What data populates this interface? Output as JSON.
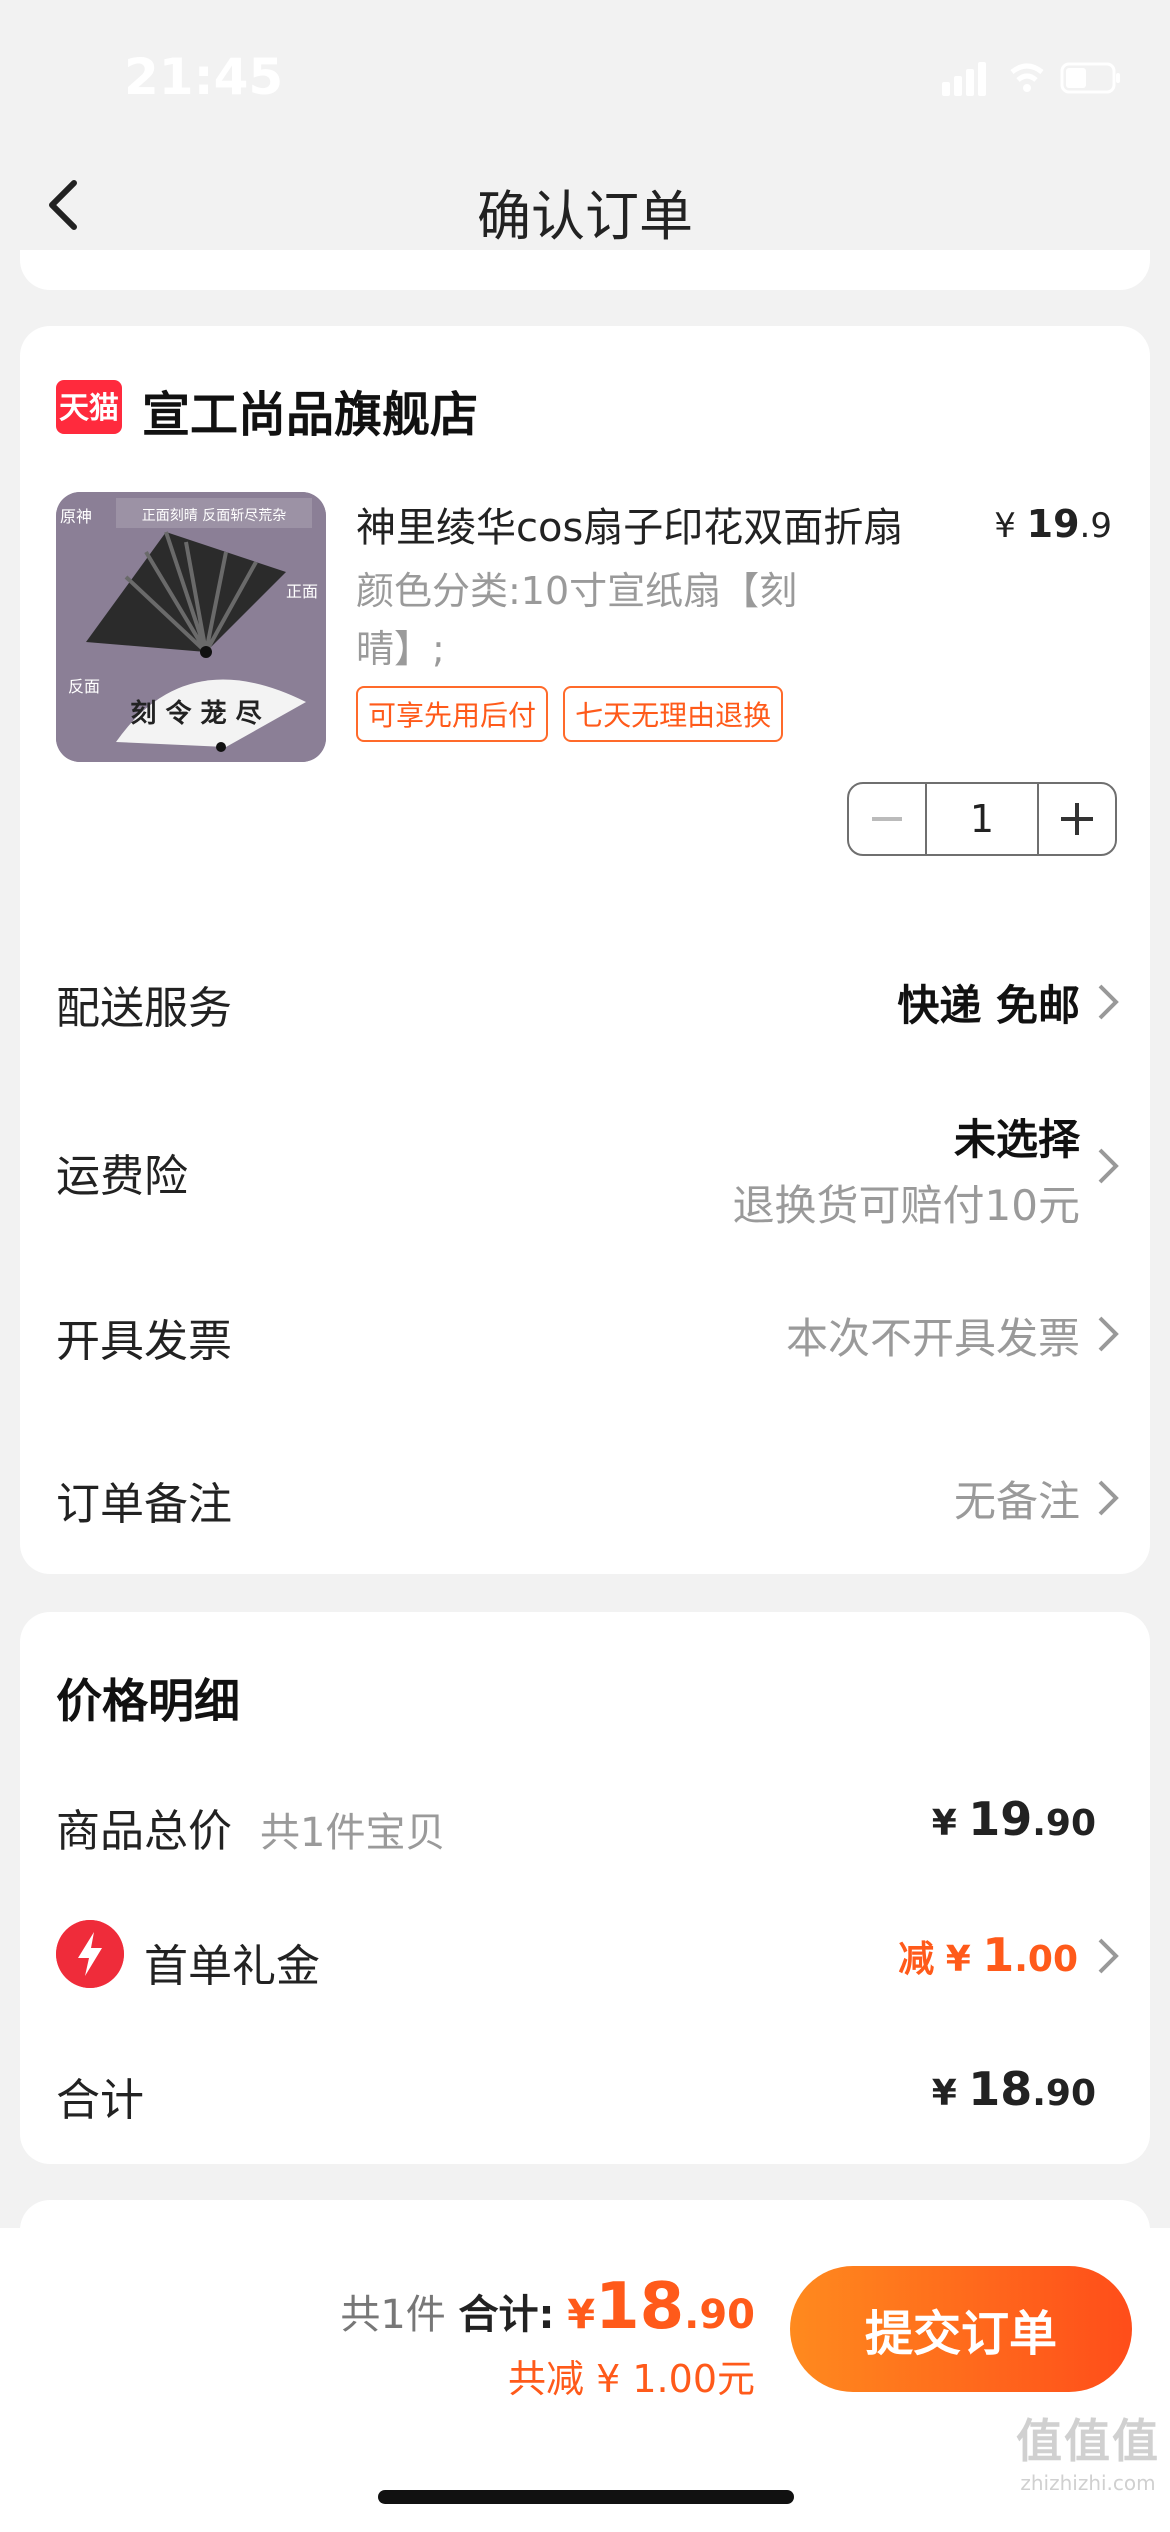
{
  "status_bar": {
    "time": "21:45"
  },
  "nav": {
    "title": "确认订单"
  },
  "shop": {
    "logo_text": "天猫",
    "name": "宣工尚品旗舰店"
  },
  "product": {
    "title": "神里绫华cos扇子印花双面折扇",
    "price_symbol": "¥",
    "price_int": "19",
    "price_dec": ".9",
    "spec": "颜色分类:10寸宣纸扇【刻晴】;",
    "tags": [
      "可享先用后付",
      "七天无理由退换"
    ],
    "quantity": "1",
    "image_text": {
      "top": "正面刻晴 反面斩尽荒杂",
      "game": "原神",
      "front": "正面",
      "back": "反面"
    }
  },
  "rows": {
    "delivery": {
      "label": "配送服务",
      "value": "快递 免邮"
    },
    "insurance": {
      "label": "运费险",
      "value": "未选择",
      "sub": "退换货可赔付10元"
    },
    "invoice": {
      "label": "开具发票",
      "value": "本次不开具发票"
    },
    "remark": {
      "label": "订单备注",
      "value": "无备注"
    }
  },
  "price_detail": {
    "title": "价格明细",
    "goods_total": {
      "label": "商品总价",
      "sub": "共1件宝贝",
      "symbol": "¥",
      "int": "19",
      "dec": ".90"
    },
    "first_order": {
      "label": "首单礼金",
      "prefix": "减",
      "symbol": "¥",
      "int": "1",
      "dec": ".00"
    },
    "total": {
      "label": "合计",
      "symbol": "¥",
      "int": "18",
      "dec": ".90"
    }
  },
  "bottom_bar": {
    "count": "共1件",
    "total_label": "合计:",
    "symbol": "¥",
    "total_int": "18",
    "total_dec": ".90",
    "discount": "共减 ¥ 1.00元",
    "submit": "提交订单"
  },
  "watermark": {
    "big": "值值值",
    "small": "zhizhizhi.com"
  },
  "colors": {
    "accent": "#ff5a1a",
    "tmall_red": "#ff2a3d"
  }
}
